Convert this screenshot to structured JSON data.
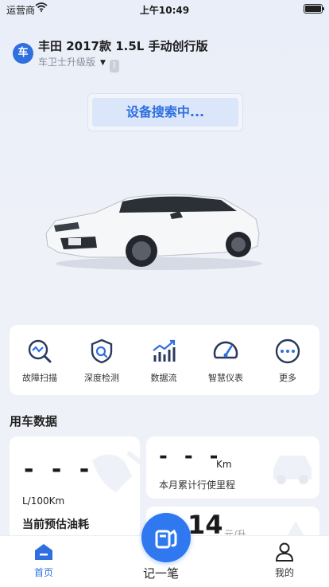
{
  "status_bar": {
    "carrier": "运营商",
    "time": "上午10:49"
  },
  "vehicle": {
    "badge": "车",
    "title": "丰田 2017款 1.5L 手动创行版",
    "device": "车卫士升级版"
  },
  "search_button": {
    "label": "设备搜索中..."
  },
  "tools": [
    {
      "label": "故障扫描",
      "icon": "fault-scan-icon"
    },
    {
      "label": "深度检测",
      "icon": "deep-check-icon"
    },
    {
      "label": "数据流",
      "icon": "data-stream-icon"
    },
    {
      "label": "智慧仪表",
      "icon": "gauge-icon"
    },
    {
      "label": "更多",
      "icon": "more-icon"
    }
  ],
  "usage": {
    "section_title": "用车数据",
    "fuel": {
      "value": "- - -",
      "unit": "L/100Km",
      "label": "当前预估油耗"
    },
    "mileage": {
      "value": "- - -",
      "unit": "Km",
      "label": "本月累计行使里程"
    },
    "cost": {
      "value": "14",
      "unit": "元/升"
    }
  },
  "tab_bar": {
    "home": "首页",
    "record": "记一笔",
    "mine": "我的"
  },
  "colors": {
    "accent": "#2f6fe0",
    "fab": "#2f78f0",
    "background": "#eef1f8"
  }
}
